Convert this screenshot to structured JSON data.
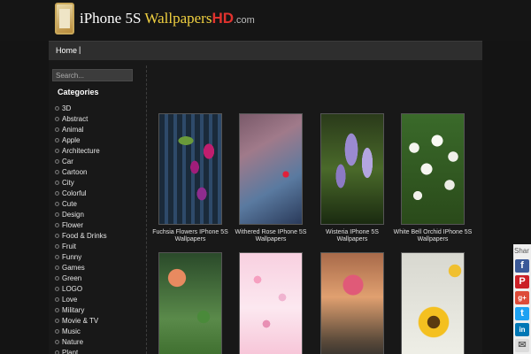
{
  "header": {
    "logo_part1": "iPhone 5S",
    "logo_part2": "Wallpapers",
    "logo_part3": "HD",
    "logo_part4": ".com"
  },
  "nav": {
    "home": "Home",
    "separator": "|"
  },
  "sidebar": {
    "search_placeholder": "Search...",
    "categories_title": "Categories",
    "categories": [
      "3D",
      "Abstract",
      "Animal",
      "Apple",
      "Architecture",
      "Car",
      "Cartoon",
      "City",
      "Colorful",
      "Cute",
      "Design",
      "Flower",
      "Food & Drinks",
      "Fruit",
      "Funny",
      "Games",
      "Green",
      "LOGO",
      "Love",
      "Military",
      "Movie & TV",
      "Music",
      "Nature",
      "Plant"
    ]
  },
  "gallery": {
    "items": [
      {
        "caption": "Fuchsia Flowers IPhone 5S Wallpapers",
        "image": "fuchsia-flowers"
      },
      {
        "caption": "Withered Rose IPhone 5S Wallpapers",
        "image": "withered-rose"
      },
      {
        "caption": "Wisteria IPhone 5S Wallpapers",
        "image": "wisteria"
      },
      {
        "caption": "White Bell Orchid IPhone 5S Wallpapers",
        "image": "white-bell-orchid"
      },
      {
        "caption": "",
        "image": "orange-flower"
      },
      {
        "caption": "",
        "image": "pink-flowers"
      },
      {
        "caption": "",
        "image": "pink-carnation"
      },
      {
        "caption": "",
        "image": "sunflower"
      }
    ]
  },
  "share": {
    "label": "Shar",
    "buttons": [
      {
        "icon": "facebook-icon",
        "glyph": "f",
        "color": "#3b5998"
      },
      {
        "icon": "pinterest-icon",
        "glyph": "P",
        "color": "#cb2027"
      },
      {
        "icon": "google-plus-icon",
        "glyph": "g+",
        "color": "#dd4b39"
      },
      {
        "icon": "twitter-icon",
        "glyph": "t",
        "color": "#1da1f2"
      },
      {
        "icon": "linkedin-icon",
        "glyph": "in",
        "color": "#0077b5"
      },
      {
        "icon": "email-icon",
        "glyph": "✉",
        "color": "#dcdcdc"
      }
    ]
  }
}
